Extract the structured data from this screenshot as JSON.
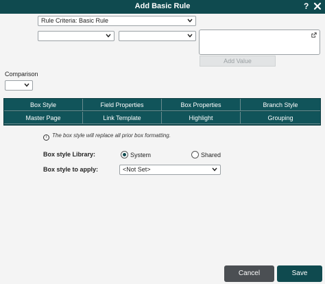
{
  "dialog": {
    "title": "Add Basic Rule",
    "help_label": "?"
  },
  "criteria": {
    "rule_select": "Rule Criteria: Basic Rule",
    "field_select": "",
    "operator_select": "",
    "value_text": "",
    "add_value_label": "Add Value"
  },
  "comparison": {
    "label": "Comparison",
    "select": ""
  },
  "tabs": [
    {
      "label": "Box Style"
    },
    {
      "label": "Field Properties"
    },
    {
      "label": "Box Properties"
    },
    {
      "label": "Branch Style"
    },
    {
      "label": "Master Page"
    },
    {
      "label": "Link Template"
    },
    {
      "label": "Highlight"
    },
    {
      "label": "Grouping"
    }
  ],
  "box_style": {
    "info_text": "The box style will replace all prior box formatting.",
    "info_icon": "i",
    "library_label": "Box style Library:",
    "library_options": [
      "System",
      "Shared"
    ],
    "library_selected": "System",
    "apply_label": "Box style to apply:",
    "apply_select": "<Not Set>"
  },
  "footer": {
    "cancel_label": "Cancel",
    "save_label": "Save"
  },
  "colors": {
    "accent": "#0f4a4f",
    "cancel": "#4b4f53"
  }
}
